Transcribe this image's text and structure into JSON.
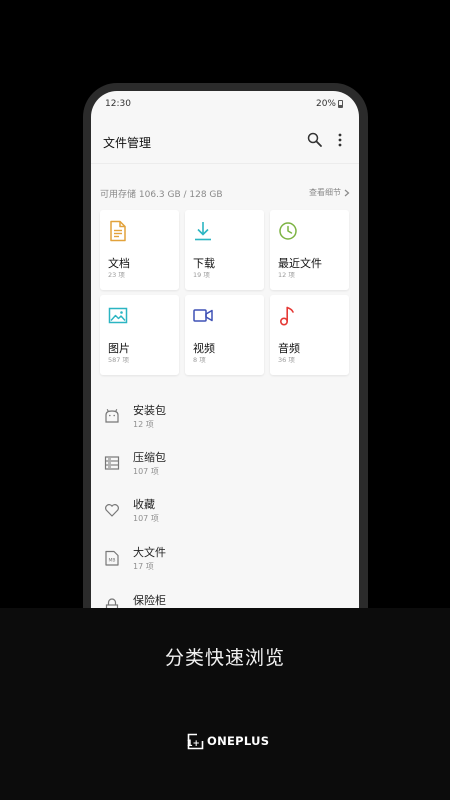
{
  "status_bar": {
    "time": "12:30",
    "battery": "20%"
  },
  "header": {
    "title": "文件管理"
  },
  "storage": {
    "text": "可用存储 106.3 GB / 128 GB",
    "details_label": "查看细节"
  },
  "categories": [
    {
      "label": "文档",
      "count": "23 项",
      "icon": "document-icon",
      "color": "#e2a23b"
    },
    {
      "label": "下载",
      "count": "19 项",
      "icon": "download-icon",
      "color": "#2bb5c2"
    },
    {
      "label": "最近文件",
      "count": "12 项",
      "icon": "clock-icon",
      "color": "#7cb342"
    },
    {
      "label": "图片",
      "count": "587 项",
      "icon": "image-icon",
      "color": "#2bb5c2"
    },
    {
      "label": "视频",
      "count": "8 项",
      "icon": "video-icon",
      "color": "#3f51b5"
    },
    {
      "label": "音频",
      "count": "36 项",
      "icon": "music-note-icon",
      "color": "#e53935"
    }
  ],
  "list": [
    {
      "label": "安装包",
      "count": "12 项",
      "icon": "android-icon"
    },
    {
      "label": "压缩包",
      "count": "107 项",
      "icon": "archive-icon"
    },
    {
      "label": "收藏",
      "count": "107 项",
      "icon": "heart-icon"
    },
    {
      "label": "大文件",
      "count": "17 项",
      "icon": "large-file-icon",
      "badge": "MB"
    },
    {
      "label": "保险柜",
      "count": "",
      "icon": "lock-icon"
    }
  ],
  "promo": {
    "tagline": "分类快速浏览",
    "brand": "ONEPLUS",
    "logo_mark": "1+"
  }
}
